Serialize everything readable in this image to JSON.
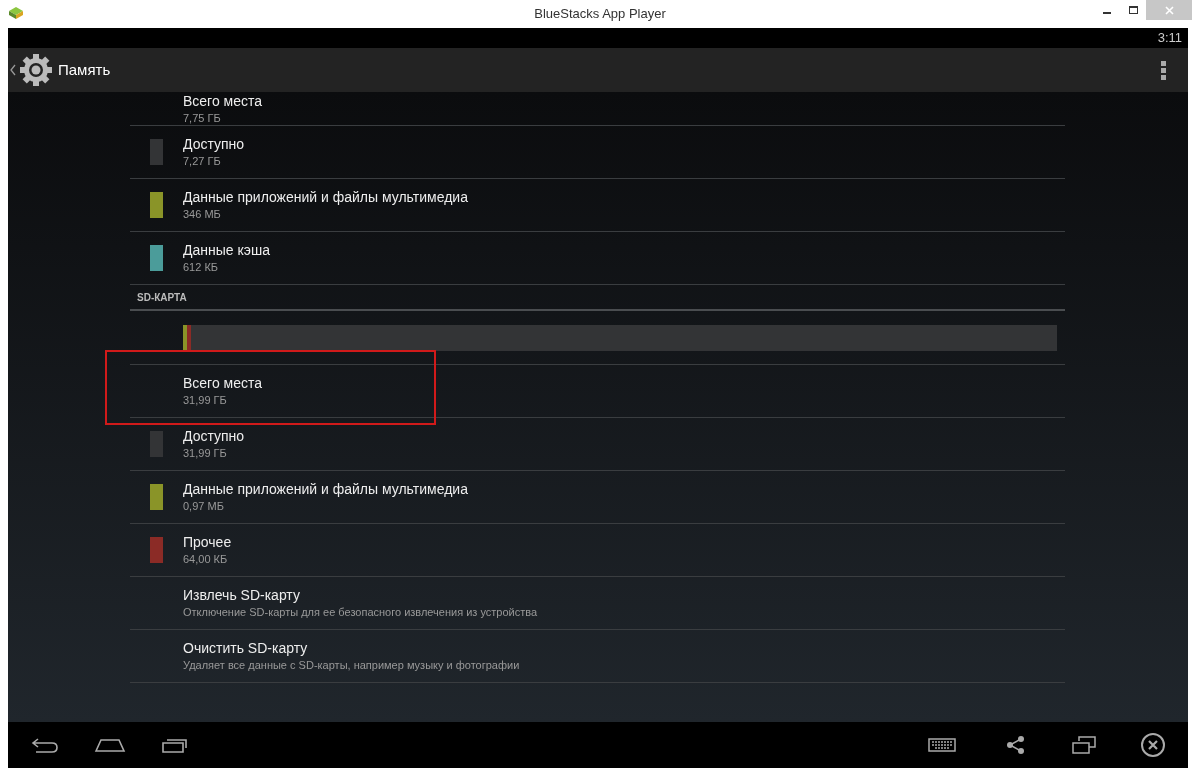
{
  "window": {
    "title": "BlueStacks App Player"
  },
  "status_bar": {
    "time": "3:11"
  },
  "action_bar": {
    "title": "Память"
  },
  "internal": [
    {
      "title": "Всего места",
      "value": "7,75 ГБ"
    },
    {
      "title": "Доступно",
      "value": "7,27 ГБ",
      "color": "#333436"
    },
    {
      "title": "Данные приложений и файлы мультимедиа",
      "value": "346 МБ",
      "color": "#8a9428"
    },
    {
      "title": "Данные кэша",
      "value": "612 КБ",
      "color": "#4b9c9a"
    }
  ],
  "sd_section": {
    "header": "SD-КАРТА",
    "usage_bar": [
      {
        "color": "#8a9428",
        "level": 0.005
      },
      {
        "color": "#8b2b26",
        "level": 0.004
      }
    ],
    "items": [
      {
        "title": "Всего места",
        "value": "31,99 ГБ",
        "highlighted": true
      },
      {
        "title": "Доступно",
        "value": "31,99 ГБ",
        "color": "#333436",
        "highlighted": false
      },
      {
        "title": "Данные приложений и файлы мультимедиа",
        "value": "0,97 МБ",
        "color": "#8a9428",
        "highlighted": false
      },
      {
        "title": "Прочее",
        "value": "64,00 КБ",
        "color": "#8b2b26",
        "highlighted": false
      }
    ],
    "actions": [
      {
        "title": "Извлечь SD-карту",
        "value": "Отключение SD-карты для ее безопасного извлечения из устройства"
      },
      {
        "title": "Очистить SD-карту",
        "value": "Удаляет все данные с SD-карты, например музыку и фотографии"
      }
    ]
  }
}
